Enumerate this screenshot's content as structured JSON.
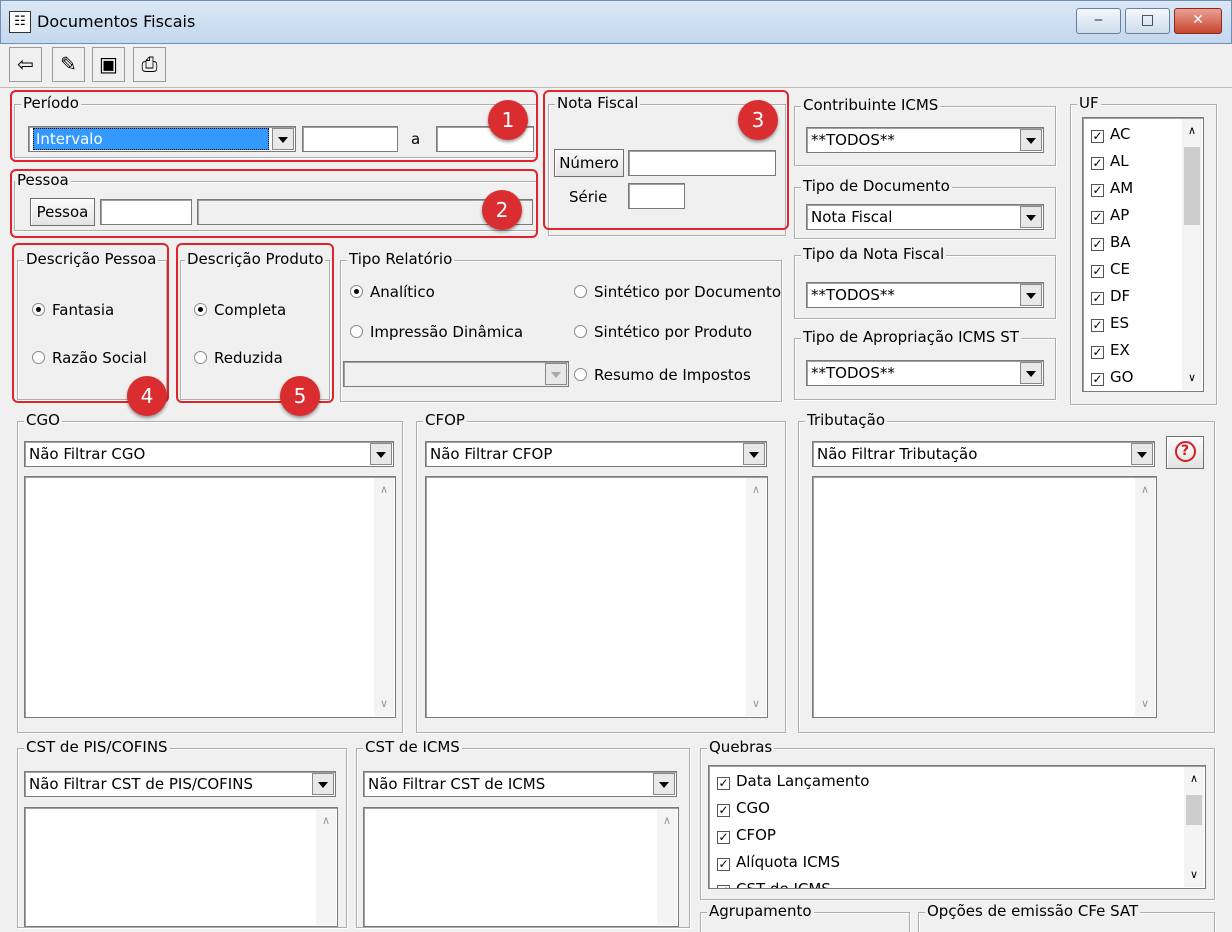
{
  "window": {
    "title": "Documentos Fiscais",
    "app_icon": "form-icon",
    "minimize_glyph": "‒",
    "maximize_glyph": "□",
    "close_glyph": "✕"
  },
  "toolbar": {
    "items": [
      "exit-icon",
      "eraser-icon",
      "save-icon",
      "print-icon"
    ]
  },
  "periodo": {
    "label": "Período",
    "mode": "Intervalo",
    "from": "",
    "separator": "a",
    "to": ""
  },
  "pessoa": {
    "label": "Pessoa",
    "button": "Pessoa",
    "code": "",
    "name": ""
  },
  "nota_fiscal": {
    "label": "Nota Fiscal",
    "numero_button": "Número",
    "numero": "",
    "serie_label": "Série",
    "serie": ""
  },
  "contribuinte": {
    "label": "Contribuinte ICMS",
    "value": "**TODOS**"
  },
  "tipo_documento": {
    "label": "Tipo de Documento",
    "value": "Nota Fiscal"
  },
  "tipo_nota": {
    "label": "Tipo da Nota Fiscal",
    "value": "**TODOS**"
  },
  "tipo_apropriacao": {
    "label": "Tipo de Apropriação ICMS ST",
    "value": "**TODOS**"
  },
  "uf": {
    "label": "UF",
    "items": [
      "AC",
      "AL",
      "AM",
      "AP",
      "BA",
      "CE",
      "DF",
      "ES",
      "EX",
      "GO"
    ]
  },
  "descricao_pessoa": {
    "label": "Descrição Pessoa",
    "options": [
      "Fantasia",
      "Razão Social"
    ],
    "selected": "Fantasia"
  },
  "descricao_produto": {
    "label": "Descrição Produto",
    "options": [
      "Completa",
      "Reduzida"
    ],
    "selected": "Completa"
  },
  "tipo_relatorio": {
    "label": "Tipo Relatório",
    "options": [
      "Analítico",
      "Impressão Dinâmica",
      "Sintético por Documento",
      "Sintético por Produto",
      "Resumo de Impostos"
    ],
    "selected": "Analítico",
    "combo_value": ""
  },
  "cgo": {
    "label": "CGO",
    "value": "Não Filtrar CGO"
  },
  "cfop": {
    "label": "CFOP",
    "value": "Não Filtrar CFOP"
  },
  "tributacao": {
    "label": "Tributação",
    "value": "Não Filtrar Tributação",
    "help_icon": "help-icon"
  },
  "cst_pis": {
    "label": "CST de PIS/COFINS",
    "value": "Não Filtrar CST de PIS/COFINS"
  },
  "cst_icms": {
    "label": "CST de ICMS",
    "value": "Não Filtrar CST de ICMS"
  },
  "quebras": {
    "label": "Quebras",
    "items": [
      "Data Lançamento",
      "CGO",
      "CFOP",
      "Alíquota ICMS",
      "CST de ICMS"
    ]
  },
  "bottom_groups": {
    "agrupamento": "Agrupamento",
    "opcoes": "Opções de emissão CFe SAT"
  },
  "badges": [
    "1",
    "2",
    "3",
    "4",
    "5"
  ],
  "colors": {
    "badge": "#d92d2f",
    "highlight_border": "#e0242c",
    "selection": "#3399ff"
  }
}
